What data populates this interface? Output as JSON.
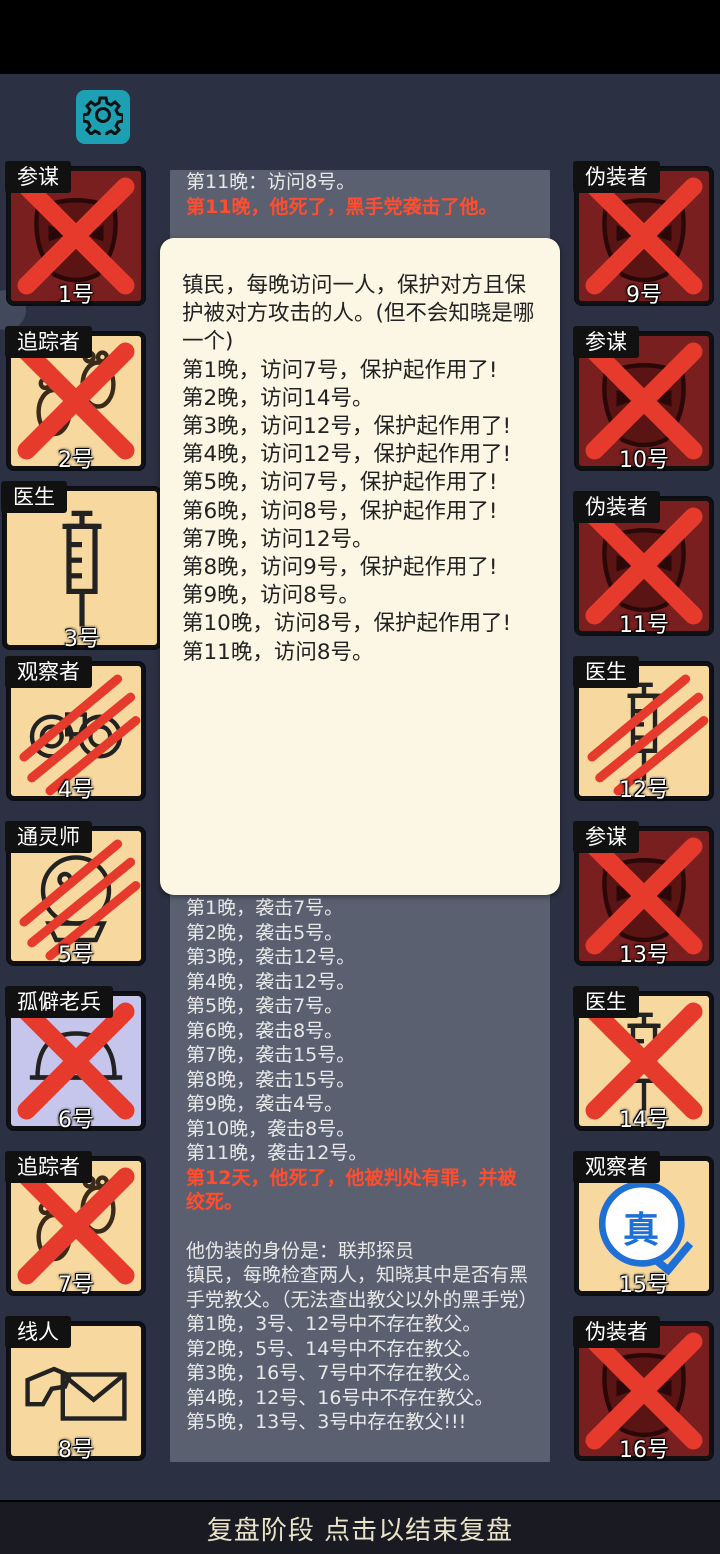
{
  "colors": {
    "background": "#2b3043",
    "gear_bg": "#1ea0b4",
    "tile_dark_red": "#7a1f1f",
    "tile_beige": "#f7d9a0",
    "tile_lavender": "#c6c6ec",
    "cross_red": "#e63a2c",
    "log_red": "#ff4d2e",
    "popup_bg": "#fbf7e4"
  },
  "settings_button": {
    "icon": "gear-icon"
  },
  "players": [
    {
      "number": "1号",
      "role": "参谋",
      "status": "dead-crossed",
      "bg": "dark-red",
      "art": "mask"
    },
    {
      "number": "2号",
      "role": "追踪者",
      "status": "dead-crossed",
      "bg": "beige",
      "art": "footprints"
    },
    {
      "number": "3号",
      "role": "医生",
      "status": "alive",
      "bg": "beige",
      "art": "syringe"
    },
    {
      "number": "4号",
      "role": "观察者",
      "status": "dead-clawed",
      "bg": "beige",
      "art": "binoculars"
    },
    {
      "number": "5号",
      "role": "通灵师",
      "status": "dead-clawed",
      "bg": "beige",
      "art": "crystal-ball"
    },
    {
      "number": "6号",
      "role": "孤僻老兵",
      "status": "dead-crossed",
      "bg": "lavender",
      "art": "helmet"
    },
    {
      "number": "7号",
      "role": "追踪者",
      "status": "dead-crossed",
      "bg": "beige",
      "art": "footprints"
    },
    {
      "number": "8号",
      "role": "线人",
      "status": "alive",
      "bg": "beige",
      "art": "envelope"
    },
    {
      "number": "9号",
      "role": "伪装者",
      "status": "dead-crossed",
      "bg": "dark-red",
      "art": "mask"
    },
    {
      "number": "10号",
      "role": "参谋",
      "status": "dead-crossed",
      "bg": "dark-red",
      "art": "mask"
    },
    {
      "number": "11号",
      "role": "伪装者",
      "status": "dead-crossed",
      "bg": "dark-red",
      "art": "mask"
    },
    {
      "number": "12号",
      "role": "医生",
      "status": "dead-clawed",
      "bg": "beige",
      "art": "syringe"
    },
    {
      "number": "13号",
      "role": "参谋",
      "status": "dead-crossed",
      "bg": "dark-red",
      "art": "mask"
    },
    {
      "number": "14号",
      "role": "医生",
      "status": "dead-crossed",
      "bg": "beige",
      "art": "syringe"
    },
    {
      "number": "15号",
      "role": "观察者",
      "status": "alive",
      "bg": "beige",
      "art": "truth-stamp",
      "stamp_text": "真"
    },
    {
      "number": "16号",
      "role": "伪装者",
      "status": "dead-crossed",
      "bg": "dark-red",
      "art": "mask"
    }
  ],
  "log": {
    "top_lines": [
      {
        "text": "第11晚：访问8号。",
        "style": "normal"
      },
      {
        "text": "第11晚，他死了，黑手党袭击了他。",
        "style": "red"
      }
    ],
    "lower_lines": [
      {
        "text": "第1晚，袭击7号。",
        "style": "normal"
      },
      {
        "text": "第2晚，袭击5号。",
        "style": "normal"
      },
      {
        "text": "第3晚，袭击12号。",
        "style": "normal"
      },
      {
        "text": "第4晚，袭击12号。",
        "style": "normal"
      },
      {
        "text": "第5晚，袭击7号。",
        "style": "normal"
      },
      {
        "text": "第6晚，袭击8号。",
        "style": "normal"
      },
      {
        "text": "第7晚，袭击15号。",
        "style": "normal"
      },
      {
        "text": "第8晚，袭击15号。",
        "style": "normal"
      },
      {
        "text": "第9晚，袭击4号。",
        "style": "normal"
      },
      {
        "text": "第10晚，袭击8号。",
        "style": "normal"
      },
      {
        "text": "第11晚，袭击12号。",
        "style": "normal"
      },
      {
        "text": "第12天，他死了，他被判处有罪，并被绞死。",
        "style": "red"
      },
      {
        "text": "",
        "style": "gap"
      },
      {
        "text": "他伪装的身份是：联邦探员",
        "style": "normal"
      },
      {
        "text": "镇民，每晚检查两人，知晓其中是否有黑手党教父。（无法查出教父以外的黑手党）",
        "style": "normal"
      },
      {
        "text": "第1晚，3号、12号中不存在教父。",
        "style": "normal"
      },
      {
        "text": "第2晚，5号、14号中不存在教父。",
        "style": "normal"
      },
      {
        "text": "第3晚，16号、7号中不存在教父。",
        "style": "normal"
      },
      {
        "text": "第4晚，12号、16号中不存在教父。",
        "style": "normal"
      },
      {
        "text": "第5晚，13号、3号中存在教父!!!",
        "style": "normal"
      }
    ]
  },
  "popup": {
    "lines": [
      "镇民，每晚访问一人，保护对方且保护被对方攻击的人。(但不会知晓是哪一个)",
      "第1晚，访问7号，保护起作用了!",
      "第2晚，访问14号。",
      "第3晚，访问12号，保护起作用了!",
      "第4晚，访问12号，保护起作用了!",
      "第5晚，访问7号，保护起作用了!",
      "第6晚，访问8号，保护起作用了!",
      "第7晚，访问12号。",
      "第8晚，访问9号，保护起作用了!",
      "第9晚，访问8号。",
      "第10晚，访问8号，保护起作用了!",
      "第11晚，访问8号。"
    ]
  },
  "bottom_bar": {
    "label": "复盘阶段 点击以结束复盘"
  }
}
